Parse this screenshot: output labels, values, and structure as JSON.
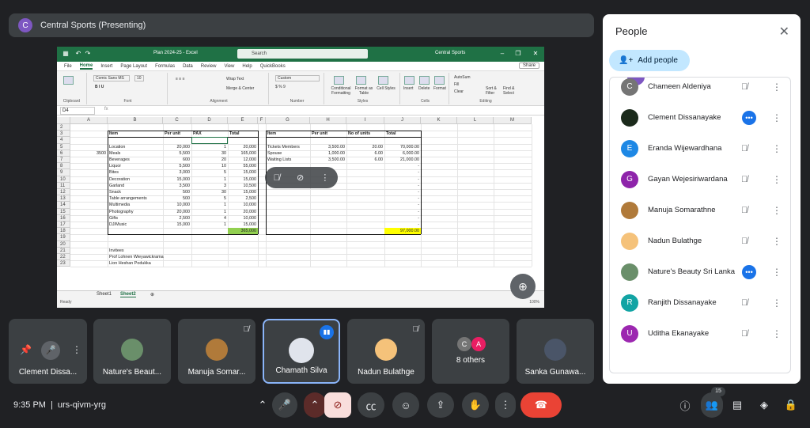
{
  "banner": {
    "avatar_letter": "C",
    "text": "Central Sports (Presenting)"
  },
  "excel": {
    "title": "Plan 2024-25 - Excel",
    "search": "Search",
    "profile": "Central Sports",
    "menu": [
      "File",
      "Home",
      "Insert",
      "Page Layout",
      "Formulas",
      "Data",
      "Review",
      "View",
      "Help",
      "QuickBooks"
    ],
    "share": "Share",
    "ribbon": {
      "font": "Comic Sans MS",
      "font_size": "10",
      "wrap": "Wrap Text",
      "merge": "Merge & Center",
      "number_format": "Custom",
      "cond": "Conditional Formatting",
      "fmt_table": "Format as Table",
      "cell_styles": "Cell Styles",
      "insert": "Insert",
      "delete": "Delete",
      "format": "Format",
      "autosum": "AutoSum",
      "fill": "Fill",
      "clear": "Clear",
      "sort": "Sort & Filter",
      "find": "Find & Select",
      "groups": [
        "Clipboard",
        "Font",
        "Alignment",
        "Number",
        "Styles",
        "Cells",
        "Editing"
      ]
    },
    "name_box": "D4",
    "fx": "fx",
    "columns": [
      "A",
      "B",
      "C",
      "D",
      "E",
      "F",
      "G",
      "H",
      "I",
      "J",
      "K",
      "L",
      "M"
    ],
    "rows": [
      "2",
      "3",
      "4",
      "5",
      "6",
      "7",
      "8",
      "9",
      "10",
      "11",
      "12",
      "13",
      "14",
      "15",
      "16",
      "17",
      "18",
      "19",
      "20",
      "21",
      "22",
      "23"
    ],
    "table1_header": [
      "Item",
      "Per unit",
      "PAX",
      "Total"
    ],
    "table1": [
      [
        "Location",
        "20,000",
        "1",
        "20,000"
      ],
      [
        "Meals",
        "5,500",
        "30",
        "165,000"
      ],
      [
        "Beverages",
        "600",
        "20",
        "12,000"
      ],
      [
        "Liquor",
        "5,500",
        "10",
        "55,000"
      ],
      [
        "Bites",
        "3,000",
        "5",
        "15,000"
      ],
      [
        "Decoration",
        "15,000",
        "1",
        "15,000"
      ],
      [
        "Garland",
        "3,500",
        "3",
        "10,500"
      ],
      [
        "Snack",
        "500",
        "30",
        "15,000"
      ],
      [
        "Table arrangements",
        "500",
        "5",
        "2,500"
      ],
      [
        "Multimedia",
        "10,000",
        "1",
        "10,000"
      ],
      [
        "Photography",
        "20,000",
        "1",
        "20,000"
      ],
      [
        "Gifts",
        "2,500",
        "4",
        "10,000"
      ],
      [
        "DJ/Music",
        "15,000",
        "1",
        "15,000"
      ]
    ],
    "total1": "365,000",
    "a6": "3500",
    "table2_header": [
      "Item",
      "Per unit",
      "No of units",
      "Total"
    ],
    "table2": [
      [
        "Tickets Members",
        "3,500.00",
        "20.00",
        "70,000.00"
      ],
      [
        "Spouse",
        "1,000.00",
        "6.00",
        "6,000.00"
      ],
      [
        "Waiting Lists",
        "3,500.00",
        "6.00",
        "21,000.00"
      ]
    ],
    "dash": "-",
    "total2": "97,000.00",
    "invitees": [
      "Invitees",
      "Prof Lohnen Wieyawickrama",
      "Lion Heshan Podukka"
    ],
    "sheets": [
      "Sheet1",
      "Sheet2"
    ],
    "status": "Ready",
    "zoom": "100%"
  },
  "tiles": [
    {
      "name": "Clement Dissa..."
    },
    {
      "name": "Nature's Beaut..."
    },
    {
      "name": "Manuja Somar..."
    },
    {
      "name": "Chamath Silva"
    },
    {
      "name": "Nadun Bulathge"
    },
    {
      "name": "8 others",
      "letters": [
        "C",
        "A"
      ]
    },
    {
      "name": "Sanka Gunawa..."
    }
  ],
  "meeting": {
    "time": "9:35 PM",
    "separator": "|",
    "code": "urs-qivm-yrg",
    "people_count": "15"
  },
  "people": {
    "title": "People",
    "add": "Add people",
    "list": [
      {
        "name": "Chameen Aldeniya",
        "letter": "C",
        "color": "#757575",
        "state": "muted"
      },
      {
        "name": "Clement Dissanayake",
        "letter": "",
        "color": "#1b2a1b",
        "state": "talking"
      },
      {
        "name": "Eranda Wijewardhana",
        "letter": "E",
        "color": "#1e88e5",
        "state": "muted"
      },
      {
        "name": "Gayan Wejesiriwardana",
        "letter": "G",
        "color": "#8e24aa",
        "state": "muted"
      },
      {
        "name": "Manuja Somarathne",
        "letter": "",
        "color": "#b07a3a",
        "state": "muted"
      },
      {
        "name": "Nadun Bulathge",
        "letter": "",
        "color": "#f5c27a",
        "state": "muted"
      },
      {
        "name": "Nature's Beauty Sri Lanka",
        "letter": "",
        "color": "#6a8f6a",
        "state": "talking"
      },
      {
        "name": "Ranjith Dissanayake",
        "letter": "R",
        "color": "#12a4a4",
        "state": "muted"
      },
      {
        "name": "Uditha Ekanayake",
        "letter": "U",
        "color": "#9c27b0",
        "state": "muted"
      }
    ]
  }
}
